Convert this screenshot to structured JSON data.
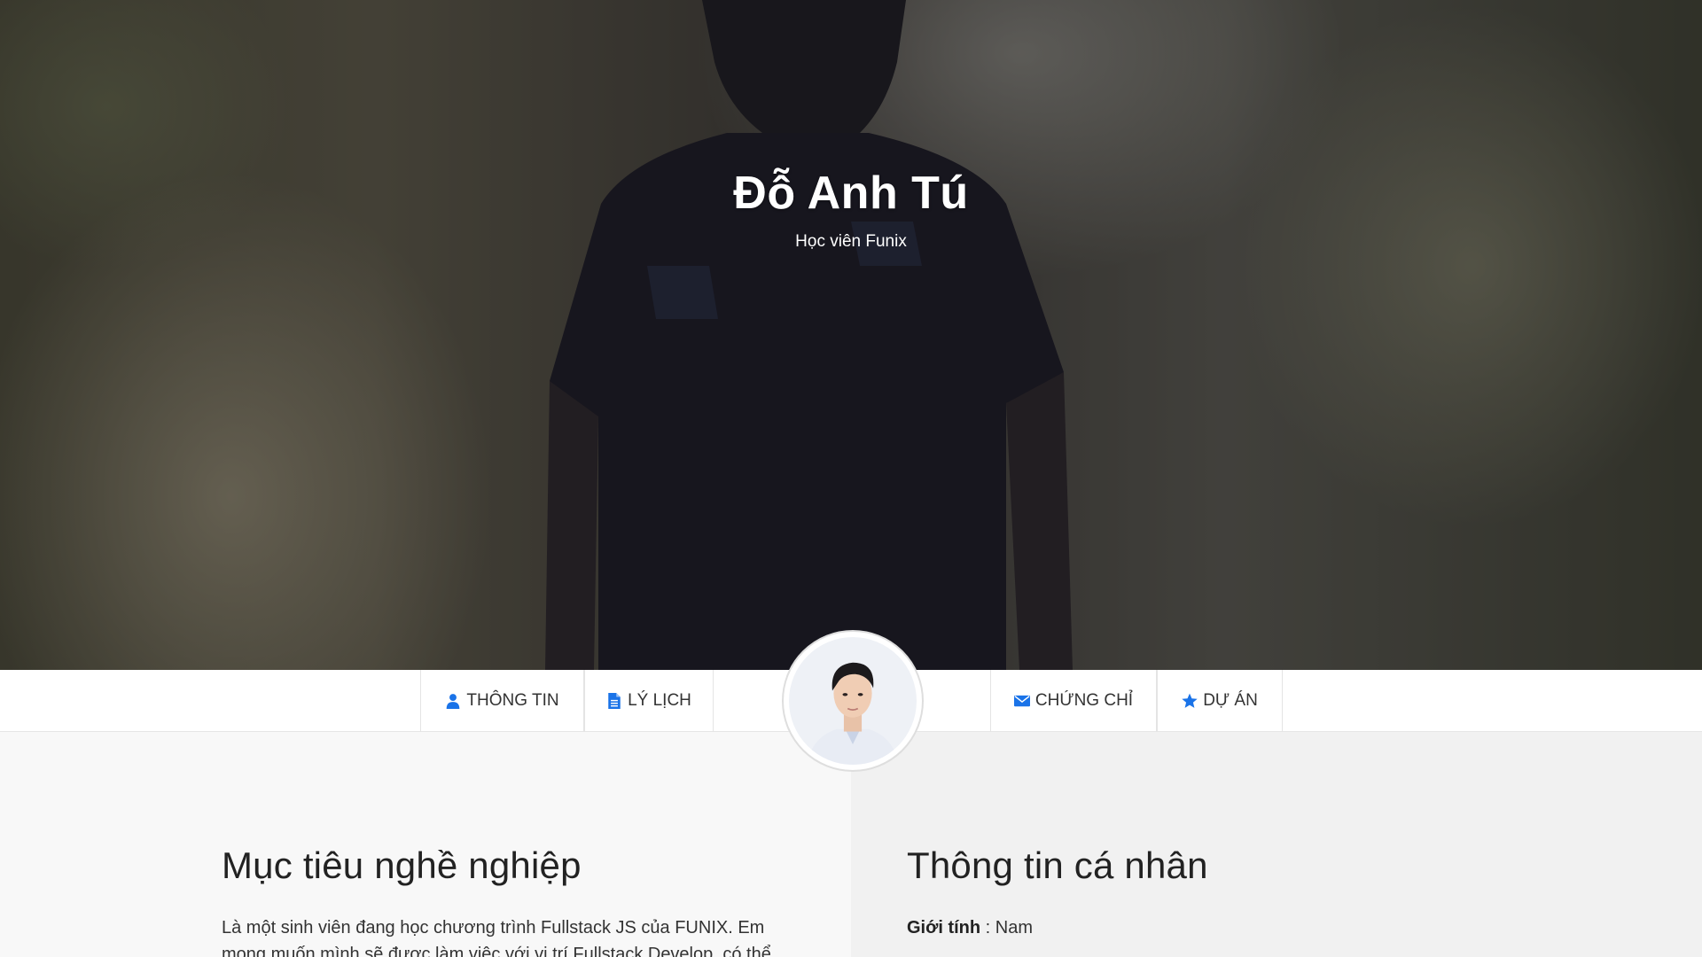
{
  "hero": {
    "name": "Đỗ Anh Tú",
    "subtitle": "Học viên Funix"
  },
  "nav": {
    "items": [
      {
        "label": "THÔNG TIN",
        "icon": "user-icon"
      },
      {
        "label": "LÝ LỊCH",
        "icon": "file-icon"
      },
      {
        "label": "CHỨNG CHỈ",
        "icon": "envelope-icon"
      },
      {
        "label": "DỰ ÁN",
        "icon": "star-icon"
      }
    ],
    "icon_color": "#1a73e8"
  },
  "career": {
    "title": "Mục tiêu nghề nghiệp",
    "text": "Là một sinh viên đang học chương trình Fullstack JS của FUNIX. Em mong muốn mình sẽ được làm việc với vị trí Fullstack Develop, có thể"
  },
  "personal": {
    "title": "Thông tin cá nhân",
    "gender_label": "Giới tính",
    "gender_value": ": Nam"
  }
}
